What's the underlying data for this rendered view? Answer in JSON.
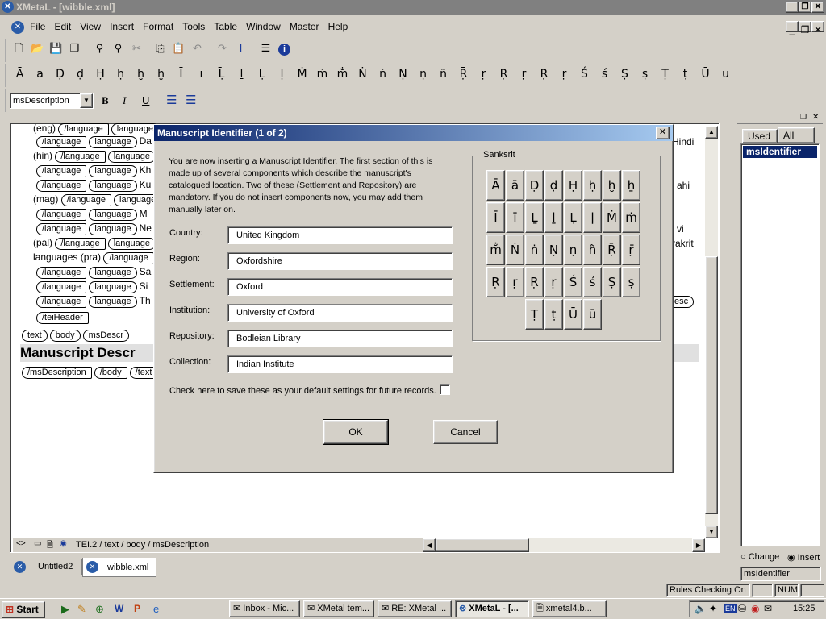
{
  "app_title": "XMetaL - [wibble.xml]",
  "menu": [
    "File",
    "Edit",
    "View",
    "Insert",
    "Format",
    "Tools",
    "Table",
    "Window",
    "Master",
    "Help"
  ],
  "char_toolbar": [
    "Ā",
    "ā",
    "Ḍ",
    "ḍ",
    "Ḥ",
    "ḥ",
    "ḫ",
    "ḫ",
    "Ī",
    "ī",
    "Ḹ",
    "ḻ",
    "Ḷ",
    "ḷ",
    "Ṁ",
    "ṁ",
    "m̐",
    "Ṅ",
    "ṅ",
    "Ṇ",
    "ṇ",
    "ñ",
    "Ṝ",
    "ṝ",
    "Ṛ",
    "ṛ",
    "Ṛ",
    "ṛ",
    "Ś",
    "ś",
    "Ṣ",
    "ṣ",
    "Ṭ",
    "ṭ",
    "Ū",
    "ū"
  ],
  "style_select": "msDescription",
  "editor": {
    "lines": [
      {
        "prefix": "(eng)",
        "tags": [
          "/language",
          "language"
        ]
      },
      {
        "prefix": "",
        "tags": [
          "/language",
          "language"
        ],
        "suffix": "Da"
      },
      {
        "prefix": "(hin)",
        "tags": [
          "/language",
          "language"
        ]
      },
      {
        "prefix": "",
        "tags": [
          "/language",
          "language"
        ],
        "suffix": "Kh"
      },
      {
        "prefix": "",
        "tags": [
          "/language",
          "language"
        ],
        "suffix": "Ku"
      },
      {
        "prefix": "(mag)",
        "tags": [
          "/language",
          "language"
        ]
      },
      {
        "prefix": "",
        "tags": [
          "/language",
          "language"
        ],
        "suffix": "M"
      },
      {
        "prefix": "",
        "tags": [
          "/language",
          "language"
        ],
        "suffix": "Ne"
      },
      {
        "prefix": "(pal)",
        "tags": [
          "/language",
          "language"
        ]
      },
      {
        "prefix": "languages (pra)",
        "tags": [
          "/language"
        ]
      },
      {
        "prefix": "",
        "tags": [
          "/language",
          "language"
        ],
        "suffix": "Sa"
      },
      {
        "prefix": "",
        "tags": [
          "/language",
          "language"
        ],
        "suffix": "Si"
      },
      {
        "prefix": "",
        "tags": [
          "/language",
          "language"
        ],
        "suffix": "Th"
      }
    ],
    "right_texts": [
      "Hindi",
      "ahi",
      "vi",
      "rakrit",
      "esc"
    ],
    "teiheader_tag": "/teiHeader",
    "row_tags": [
      "text",
      "body",
      "msDescr"
    ],
    "heading": "Manuscript Descr",
    "bottom_tags": [
      "/msDescription",
      "/body",
      "/text"
    ],
    "breadcrumb": "TEI.2 / text / body / msDescription"
  },
  "doc_tabs": [
    "Untitled2",
    "wibble.xml"
  ],
  "right_panel": {
    "tabs": [
      "Used",
      "All"
    ],
    "selected_item": "msIdentifier",
    "radio_change": "Change",
    "radio_insert": "Insert",
    "bottom_field": "msIdentifier"
  },
  "status_bar": {
    "rules": "Rules Checking On",
    "num": "NUM"
  },
  "dialog": {
    "title": "Manuscript Identifier (1 of 2)",
    "description": "You are now inserting a Manuscript Identifier.  The first section of this is made up of several components which describe the manuscript's catalogued location.  Two of these (Settlement and Repository) are mandatory.  If you do not insert components now, you may add them manually later on.",
    "fields": [
      {
        "label": "Country:",
        "value": "United Kingdom"
      },
      {
        "label": "Region:",
        "value": "Oxfordshire"
      },
      {
        "label": "Settlement:",
        "value": "Oxford"
      },
      {
        "label": "Institution:",
        "value": "University of Oxford"
      },
      {
        "label": "Repository:",
        "value": "Bodleian Library"
      },
      {
        "label": "Collection:",
        "value": "Indian Institute"
      }
    ],
    "checkbox_label": "Check here to save these as your default settings for future records.",
    "ok": "OK",
    "cancel": "Cancel",
    "group_title": "Sanksrit",
    "chars": [
      [
        "Ā",
        "ā",
        "Ḍ",
        "ḍ",
        "Ḥ",
        "ḥ",
        "ḫ",
        "ẖ"
      ],
      [
        "Ī",
        "ī",
        "Ḻ",
        "ḻ",
        "Ḷ",
        "ḷ",
        "Ṁ",
        "ṁ"
      ],
      [
        "m̐",
        "Ṅ",
        "ṅ",
        "Ṇ",
        "ṇ",
        "ñ",
        "Ṝ",
        "ṝ"
      ],
      [
        "Ṛ",
        "ṛ",
        "Ṛ",
        "ṛ",
        "Ś",
        "ś",
        "Ṣ",
        "ṣ"
      ],
      [
        "Ṭ",
        "ṭ",
        "Ū",
        "ū"
      ]
    ]
  },
  "taskbar": {
    "start": "Start",
    "items": [
      "Inbox - Mic...",
      "XMetal tem...",
      "RE: XMetal ...",
      "XMetaL - [...",
      "xmetal4.b..."
    ],
    "clock": "15:25",
    "lang": "EN"
  }
}
